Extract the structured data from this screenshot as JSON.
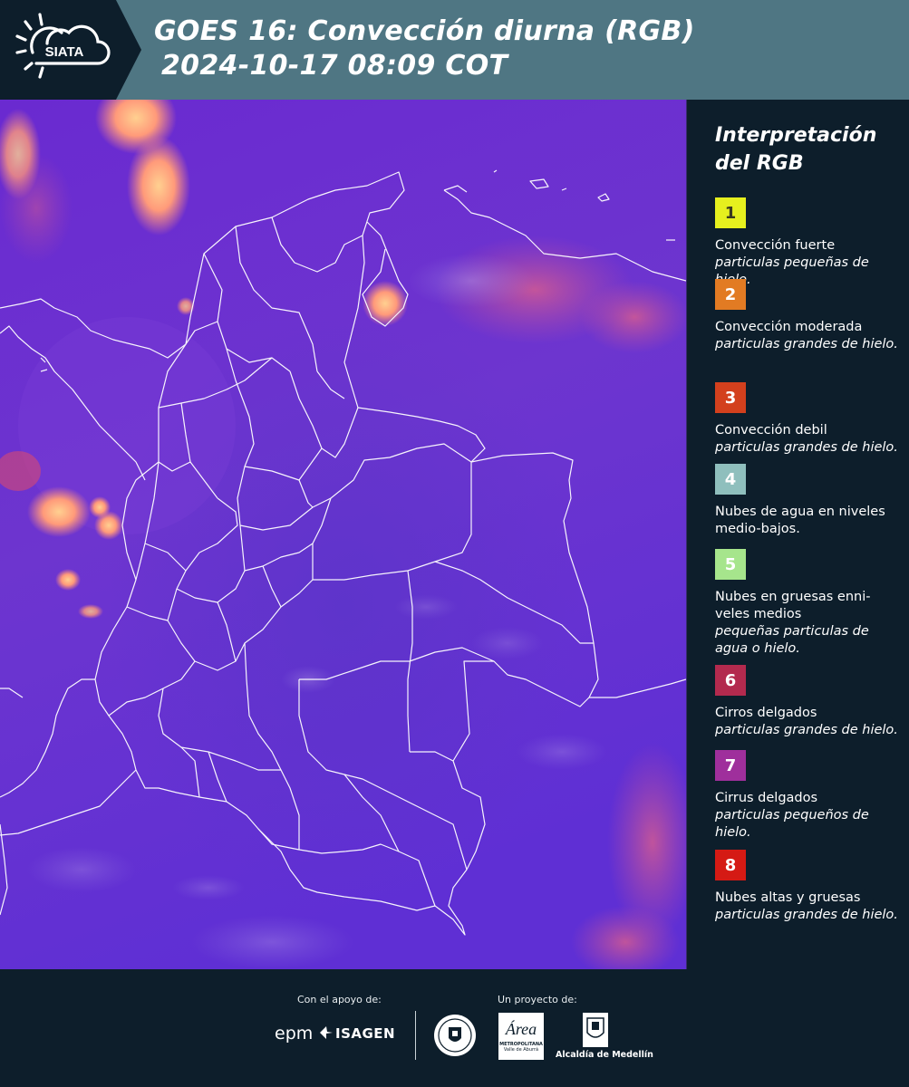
{
  "header": {
    "logo_text": "SIATA",
    "title_line1": "GOES 16: Convección diurna (RGB)",
    "title_line2": "2024-10-17 08:09 COT"
  },
  "colors": {
    "header_bg": "#4f7683",
    "dark_bg": "#0d1e2b",
    "map_base": "#6a2fd1"
  },
  "legend": {
    "title_line1": "Interpretación",
    "title_line2": "del RGB",
    "items": [
      {
        "num": "1",
        "color": "#e6f01e",
        "num_color": "#3a3a20",
        "name": "Convección fuerte",
        "desc": "particulas pequeñas de hielo."
      },
      {
        "num": "2",
        "color": "#e27b23",
        "num_color": "#ffffff",
        "name": "Convección moderada",
        "desc": "particulas grandes de hielo."
      },
      {
        "num": "3",
        "color": "#d3401d",
        "num_color": "#ffffff",
        "name": "Convección debil",
        "desc": "particulas grandes de hielo."
      },
      {
        "num": "4",
        "color": "#8fbfbd",
        "num_color": "#ffffff",
        "name": "Nubes de agua en niveles medio-bajos.",
        "desc": ""
      },
      {
        "num": "5",
        "color": "#a6e58c",
        "num_color": "#ffffff",
        "name": "Nubes en gruesas enni-veles medios",
        "desc": "pequeñas particulas de agua o hielo."
      },
      {
        "num": "6",
        "color": "#b32a4e",
        "num_color": "#ffffff",
        "name": "Cirros delgados",
        "desc": "particulas grandes de hielo."
      },
      {
        "num": "7",
        "color": "#9f2f9c",
        "num_color": "#ffffff",
        "name": "Cirrus delgados",
        "desc": "particulas pequeños de hielo."
      },
      {
        "num": "8",
        "color": "#d51a14",
        "num_color": "#ffffff",
        "name": "Nubes altas y gruesas",
        "desc": "particulas grandes de hielo."
      }
    ]
  },
  "footer": {
    "support_label": "Con el apoyo de:",
    "project_label": "Un proyecto de:",
    "epm_logo": "epm",
    "isagen_logo": "ISAGEN",
    "area_logo": "Área",
    "area_sub1": "METROPOLITANA",
    "area_sub2": "Valle de Aburrá",
    "alcaldia_logo": "Alcaldía de Medellín"
  }
}
